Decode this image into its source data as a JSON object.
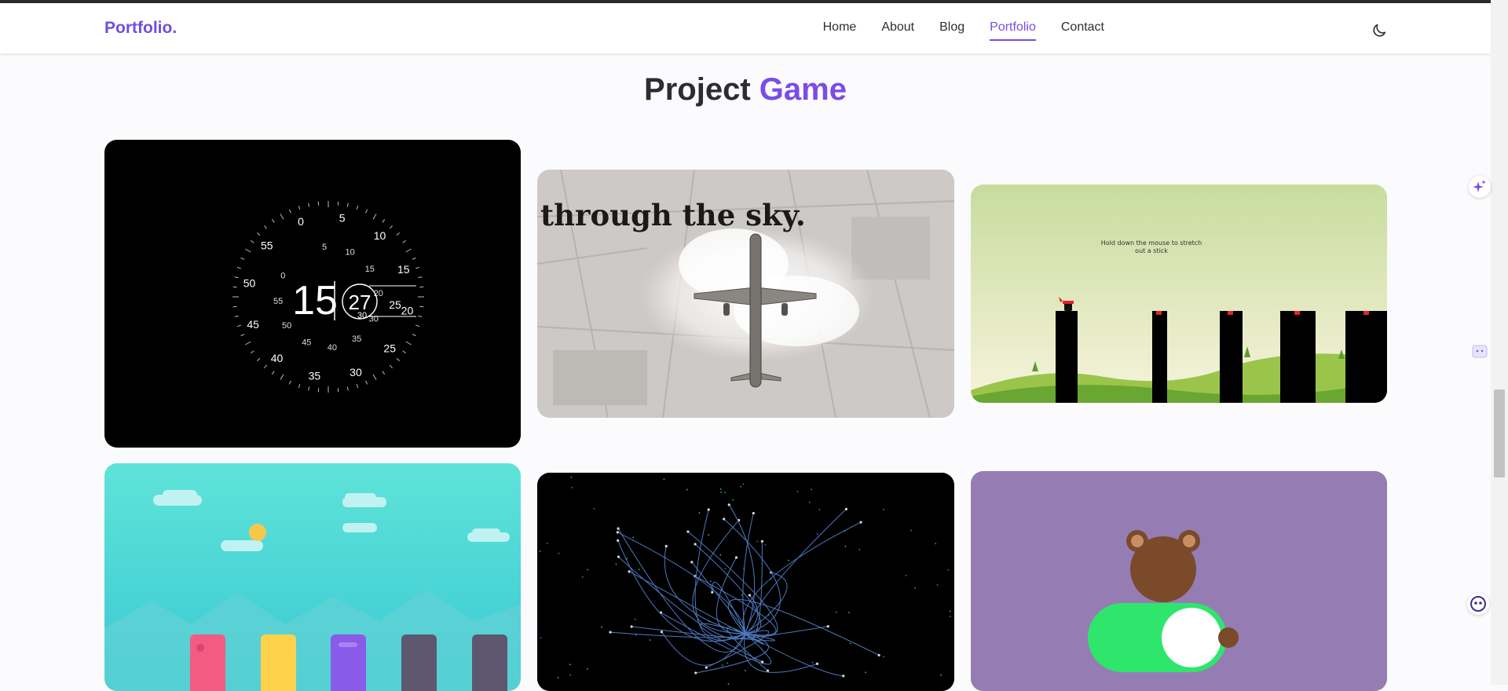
{
  "nav": {
    "brand": "Portfolio.",
    "items": [
      {
        "label": "Home"
      },
      {
        "label": "About"
      },
      {
        "label": "Blog"
      },
      {
        "label": "Portfolio",
        "active": true
      },
      {
        "label": "Contact"
      }
    ],
    "theme_toggle_icon": "moon-icon"
  },
  "section": {
    "title_main": "Project",
    "title_accent": "Game"
  },
  "cards": {
    "clock": {
      "hour": "15",
      "minute": "27",
      "minute_next": "30",
      "minute_prev": "25",
      "outer_ticks": [
        "5",
        "10",
        "15",
        "20",
        "25",
        "30",
        "35",
        "40",
        "45",
        "50",
        "55",
        "0"
      ],
      "inner_ticks": [
        "5",
        "10",
        "15",
        "20",
        "30",
        "35",
        "40",
        "45",
        "50",
        "55",
        "0"
      ]
    },
    "plane": {
      "text": "through the sky."
    },
    "stick_hero": {
      "hint_line1": "Hold down the mouse to stretch",
      "hint_line2": "out a stick"
    }
  },
  "colors": {
    "accent": "#7a4ce8",
    "brand": "#6e4ee0",
    "stick_sky_top": "#c8dc9e",
    "jump_bg": "#4fdcd8",
    "toggle_green": "#2ee66b",
    "toggle_bg": "#957db3"
  },
  "side_icons": [
    "sparkle-icon",
    "chat-bubble-icon",
    "assistant-icon"
  ]
}
